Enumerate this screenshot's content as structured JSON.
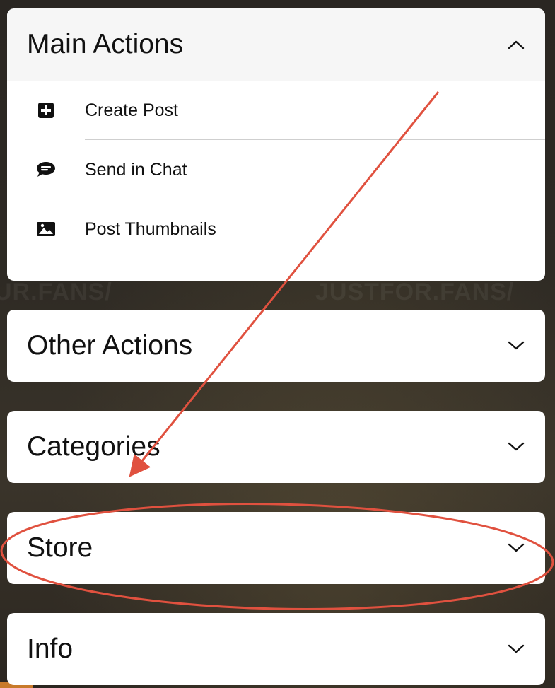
{
  "background": {
    "watermark_left": "UR.FANS/",
    "watermark_right": "JUSTFOR.FANS/"
  },
  "panels": {
    "main": {
      "title": "Main Actions",
      "state": "expanded",
      "items": [
        {
          "label": "Create Post",
          "icon": "plus-square-icon"
        },
        {
          "label": "Send in Chat",
          "icon": "chat-bubble-icon"
        },
        {
          "label": "Post Thumbnails",
          "icon": "image-icon"
        }
      ]
    },
    "other": {
      "title": "Other Actions",
      "state": "collapsed"
    },
    "categories": {
      "title": "Categories",
      "state": "collapsed"
    },
    "store": {
      "title": "Store",
      "state": "collapsed"
    },
    "info": {
      "title": "Info",
      "state": "collapsed"
    }
  },
  "annotation": {
    "color": "#e0513f",
    "target": "Store"
  }
}
